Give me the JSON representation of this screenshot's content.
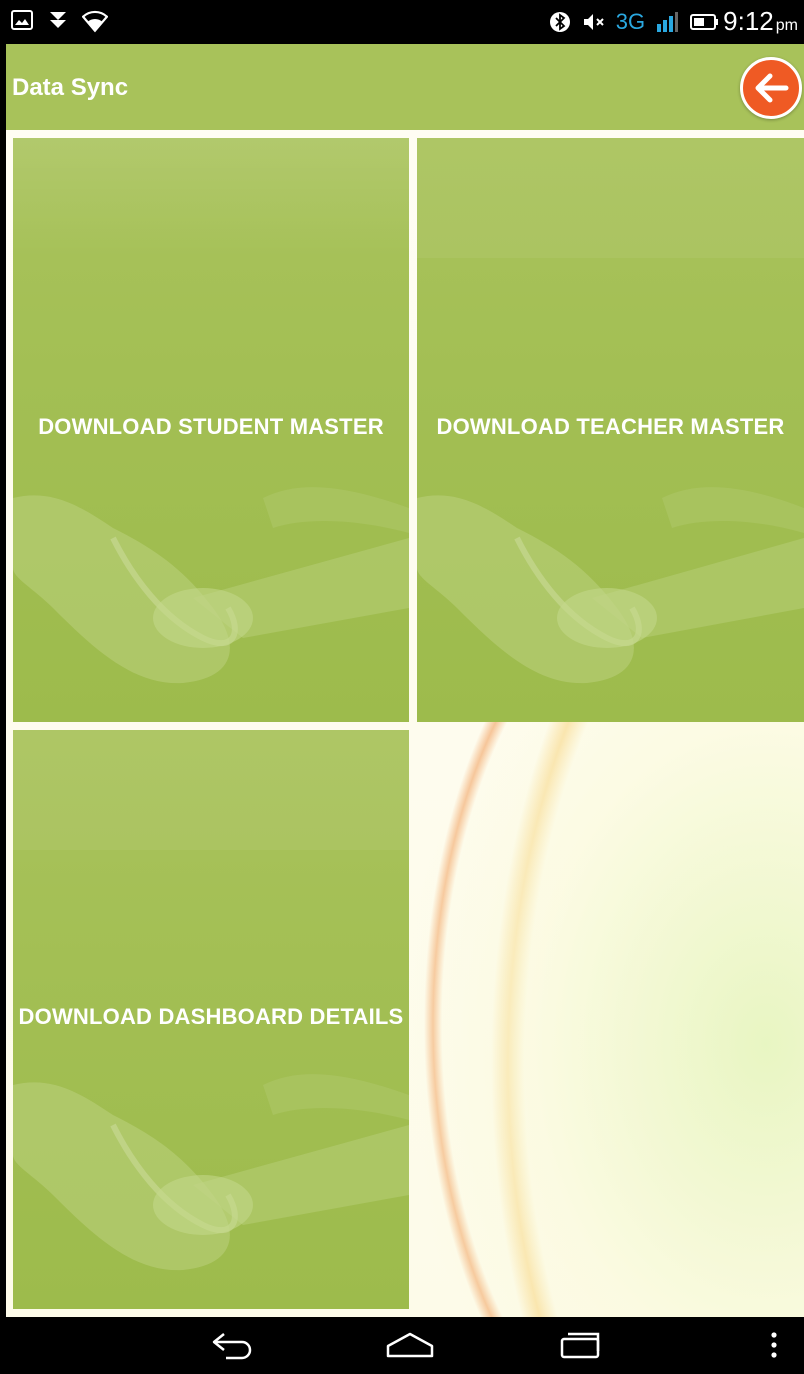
{
  "status_bar": {
    "left_icons": [
      "image-icon",
      "download-icon",
      "wifi-icon"
    ],
    "right_icons": [
      "bluetooth-icon",
      "mute-icon",
      "signal-icon",
      "battery-icon"
    ],
    "network_type": "3G",
    "time": "9:12",
    "ampm": "pm"
  },
  "toolbar": {
    "title": "Data Sync",
    "back_icon": "back-arrow-icon",
    "accent_color": "#ef5a24",
    "bar_color": "#a8c25a"
  },
  "tiles": [
    {
      "label": "DOWNLOAD STUDENT MASTER"
    },
    {
      "label": "DOWNLOAD TEACHER MASTER"
    },
    {
      "label": "DOWNLOAD DASHBOARD DETAILS"
    }
  ],
  "nav_bar": {
    "icons": [
      "nav-back-icon",
      "nav-home-icon",
      "nav-recents-icon",
      "overflow-menu-icon"
    ]
  }
}
